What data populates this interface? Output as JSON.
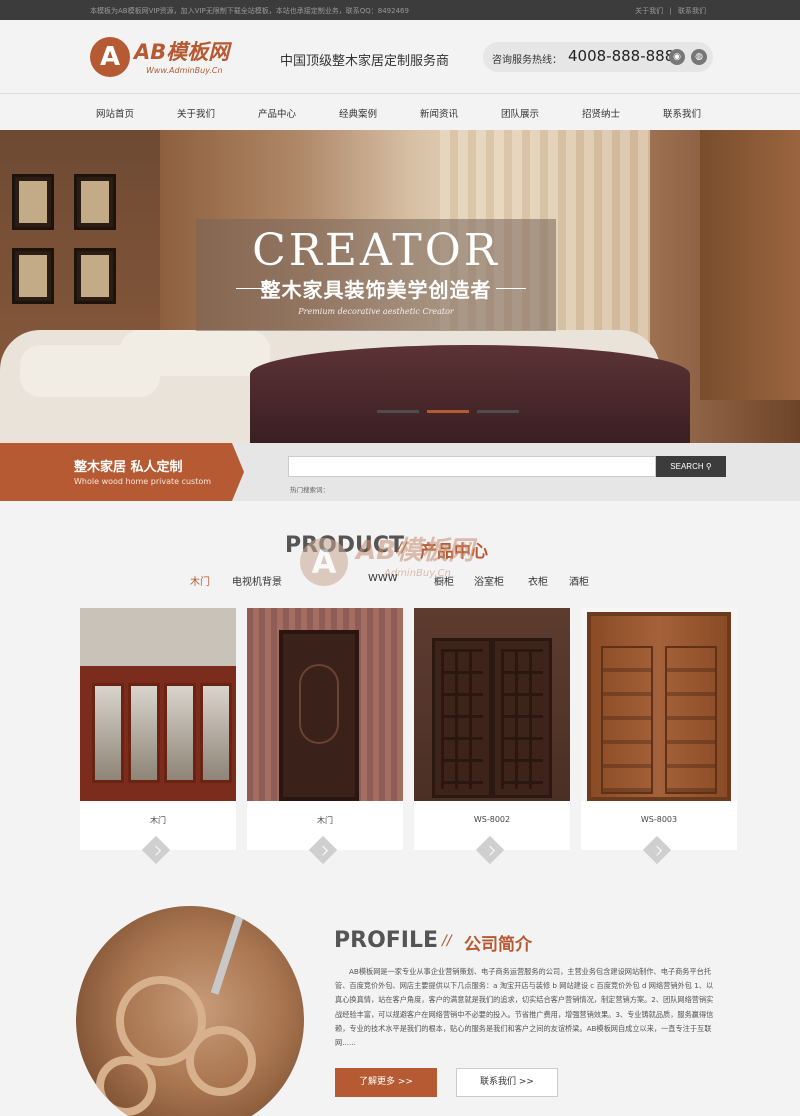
{
  "topbar": {
    "notice": "本模板为AB模板网VIP资源，加入VIP无限制下载全站模板，本站也承接定制业务，联系QQ：8492469",
    "links": [
      "关于我们",
      "|",
      "联系我们"
    ]
  },
  "header": {
    "logo_mark": "A",
    "logo_text": "AB模板网",
    "logo_sub": "Www.AdminBuy.Cn",
    "slogan": "中国顶级整木家居定制服务商",
    "hotline_label": "咨询服务热线：",
    "hotline_number": "4008-888-888"
  },
  "nav": {
    "items": [
      "网站首页",
      "关于我们",
      "产品中心",
      "经典案例",
      "新闻资讯",
      "团队展示",
      "招贤纳士",
      "联系我们"
    ]
  },
  "hero": {
    "title_en": "CREATOR",
    "title_cn": "整木家具装饰美学创造者",
    "subtitle": "Premium decorative aesthetic Creator",
    "slide_count": 3,
    "active_slide": 2
  },
  "strip": {
    "title": "整木家居  私人定制",
    "subtitle": "Whole wood   home private custom",
    "search_button": "SEARCH",
    "search_value": "",
    "hot_search": "热门搜索词："
  },
  "products": {
    "title_en": "PRODUCT",
    "title_sep": "//",
    "title_cn": "产品中心",
    "watermark_mark": "A",
    "watermark_text": "AB模板网",
    "watermark_sub": "AdminBuy.Cn",
    "categories": [
      "木门",
      "电视机背景",
      "WWW",
      "橱柜",
      "浴室柜",
      "衣柜",
      "酒柜"
    ],
    "active_category": 0,
    "items": [
      {
        "caption": "木门"
      },
      {
        "caption": "木门"
      },
      {
        "caption": "WS-8002"
      },
      {
        "caption": "WS-8003"
      }
    ]
  },
  "profile": {
    "title_en": "PROFILE",
    "title_sep": "//",
    "title_cn": "公司简介",
    "body": "AB模板网是一家专业从事企业营销策划、电子商务运营服务的公司，主营业务包含建设网站制作、电子商务平台托管、百度竞价外包、网店主要提供以下几点服务：a 淘宝开店与装修 b 网站建设 c 百度竞价外包 d 网络营销外包 1、以真心换真情，站在客户角度，客户的满意就是我们的追求，切实结合客户营销情况，制定营销方案。2、团队网络营销实战经验丰富，可以规避客户在网络营销中不必要的投入。节省推广费用，增强营销效果。3、专业铸就品质，服务赢得信赖，专业的技术水平是我们的根本，贴心的服务是我们和客户之间的友谊桥梁。AB模板网自成立以来，一直专注于互联网......",
    "more_button": "了解更多 >>",
    "contact_button": "联系我们 >>"
  },
  "colors": {
    "accent": "#b55a32",
    "topbar": "#3c3c3c",
    "background": "#f3f3f3"
  },
  "icons": [
    "weibo-icon",
    "wechat-icon",
    "search-icon",
    "chevron-right-icon"
  ]
}
